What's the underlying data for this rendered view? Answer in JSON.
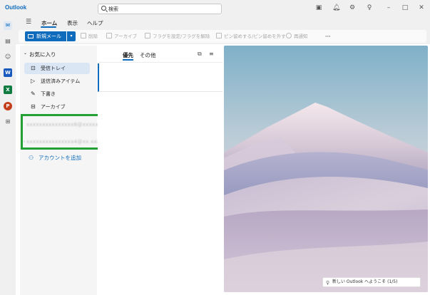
{
  "app": {
    "title": "Outlook"
  },
  "search": {
    "placeholder": "検索"
  },
  "tabs": {
    "home": "ホーム",
    "view": "表示",
    "help": "ヘルプ"
  },
  "ribbon": {
    "new_mail": "新規メール",
    "delete": "削除",
    "archive": "アーカイブ",
    "flag": "フラグを設定/フラグを解除",
    "pin": "ピン留めする/ピン留めを外す",
    "snooze": "再通知",
    "more": "···"
  },
  "nav": {
    "favorites": "お気に入り",
    "inbox": "受信トレイ",
    "sent": "送信済みアイテム",
    "drafts": "下書き",
    "archive": "アーカイブ",
    "add_account": "アカウントを追加"
  },
  "accounts": [
    {
      "label": "xxxxxxxxxxxxxxx6@xxxxx"
    },
    {
      "label": "xxxxxxxxxxxxxxx4@xx.xxxxx"
    }
  ],
  "messages": {
    "focused": "優先",
    "other": "その他"
  },
  "toast": {
    "text": "新しい Outlook へようこそ (1/5)"
  },
  "colors": {
    "accent": "#0f6cbd",
    "highlight_box": "#23a033"
  }
}
